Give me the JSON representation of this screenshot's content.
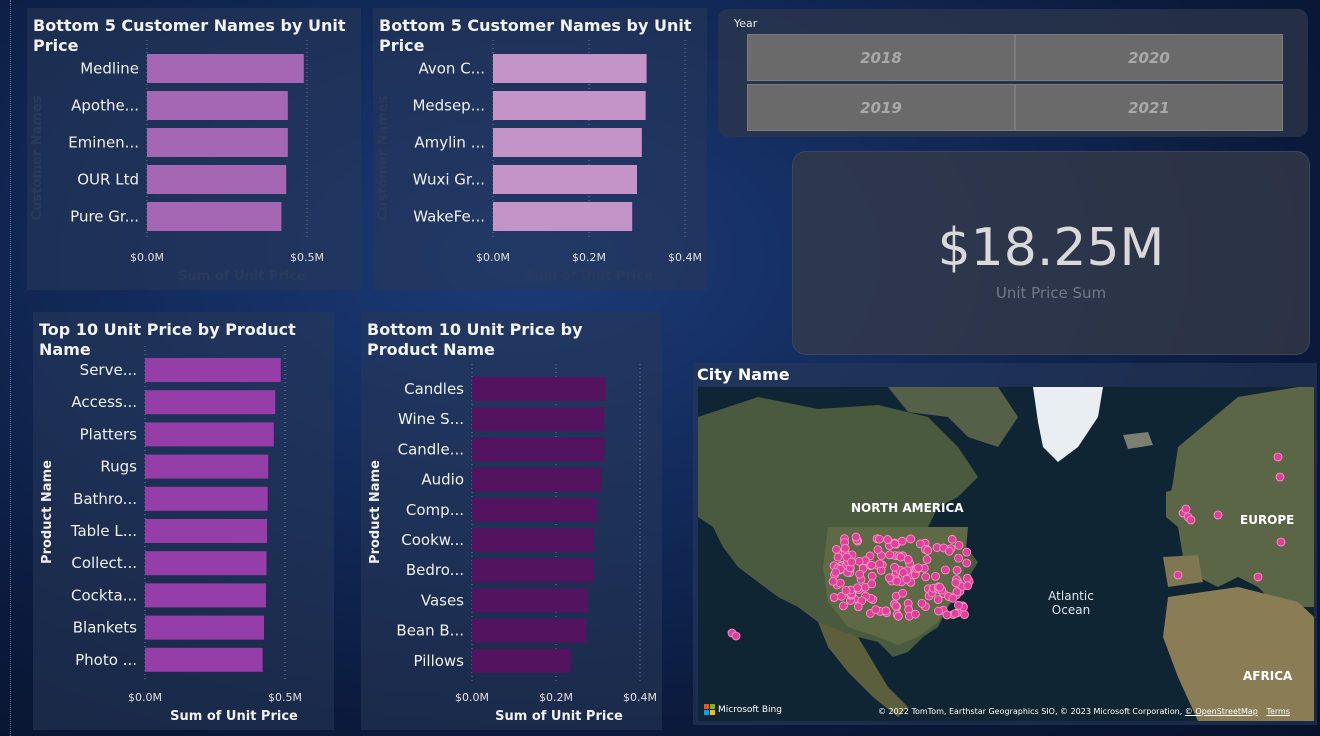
{
  "charts": {
    "c1": {
      "title": "Bottom 5 Customer Names by Unit Price",
      "xlabel": "Sum of Unit Price",
      "ylabel": "Customer Names",
      "color": "#a566b4",
      "categories": [
        "Medline",
        "Apothe...",
        "Eminen...",
        "OUR Ltd",
        "Pure Gr..."
      ],
      "values": [
        0.49,
        0.44,
        0.44,
        0.435,
        0.42
      ],
      "ticks": [
        "$0.0M",
        "$0.5M"
      ]
    },
    "c2": {
      "title": "Bottom 5 Customer Names by Unit Price",
      "xlabel": "Sum of Unit Price",
      "ylabel": "Customer Names",
      "color": "#c494c8",
      "categories": [
        "Avon C...",
        "Medsep...",
        "Amylin ...",
        "Wuxi Gr...",
        "WakeFe..."
      ],
      "values": [
        0.32,
        0.318,
        0.31,
        0.3,
        0.29
      ],
      "ticks": [
        "$0.0M",
        "$0.2M",
        "$0.4M"
      ]
    },
    "c3": {
      "title": "Top 10 Unit Price by Product Name",
      "xlabel": "Sum of Unit Price",
      "ylabel": "Product Name",
      "color": "#953ea8",
      "categories": [
        "Serve...",
        "Access...",
        "Platters",
        "Rugs",
        "Bathro...",
        "Table L...",
        "Collect...",
        "Cockta...",
        "Blankets",
        "Photo ..."
      ],
      "values": [
        0.485,
        0.465,
        0.46,
        0.44,
        0.438,
        0.436,
        0.434,
        0.432,
        0.425,
        0.42
      ],
      "ticks": [
        "$0.0M",
        "$0.5M"
      ]
    },
    "c4": {
      "title": "Bottom 10 Unit Price by Product Name",
      "xlabel": "Sum of Unit Price",
      "ylabel": "Product Name",
      "color": "#54135f",
      "categories": [
        "Candles",
        "Wine S...",
        "Candle...",
        "Audio",
        "Comp...",
        "Cookw...",
        "Bedro...",
        "Vases",
        "Bean B...",
        "Pillows"
      ],
      "values": [
        0.318,
        0.315,
        0.315,
        0.308,
        0.298,
        0.29,
        0.29,
        0.275,
        0.272,
        0.235
      ],
      "ticks": [
        "$0.0M",
        "$0.2M",
        "$0.4M"
      ]
    }
  },
  "slicer": {
    "label": "Year",
    "options": [
      "2018",
      "2020",
      "2019",
      "2021"
    ]
  },
  "kpi": {
    "value": "$18.25M",
    "label": "Unit Price Sum"
  },
  "map": {
    "title": "City Name",
    "labels": {
      "north_america": "NORTH AMERICA",
      "europe": "EUROPE",
      "atlantic": "Atlantic\nOcean",
      "africa": "AFRICA"
    },
    "bing": "Microsoft Bing",
    "attribution": "© 2022 TomTom, Earthstar Geographics SIO, © 2023 Microsoft Corporation,",
    "osm": "© OpenStreetMap",
    "terms": "Terms",
    "dot_color": "#e0409a"
  }
}
